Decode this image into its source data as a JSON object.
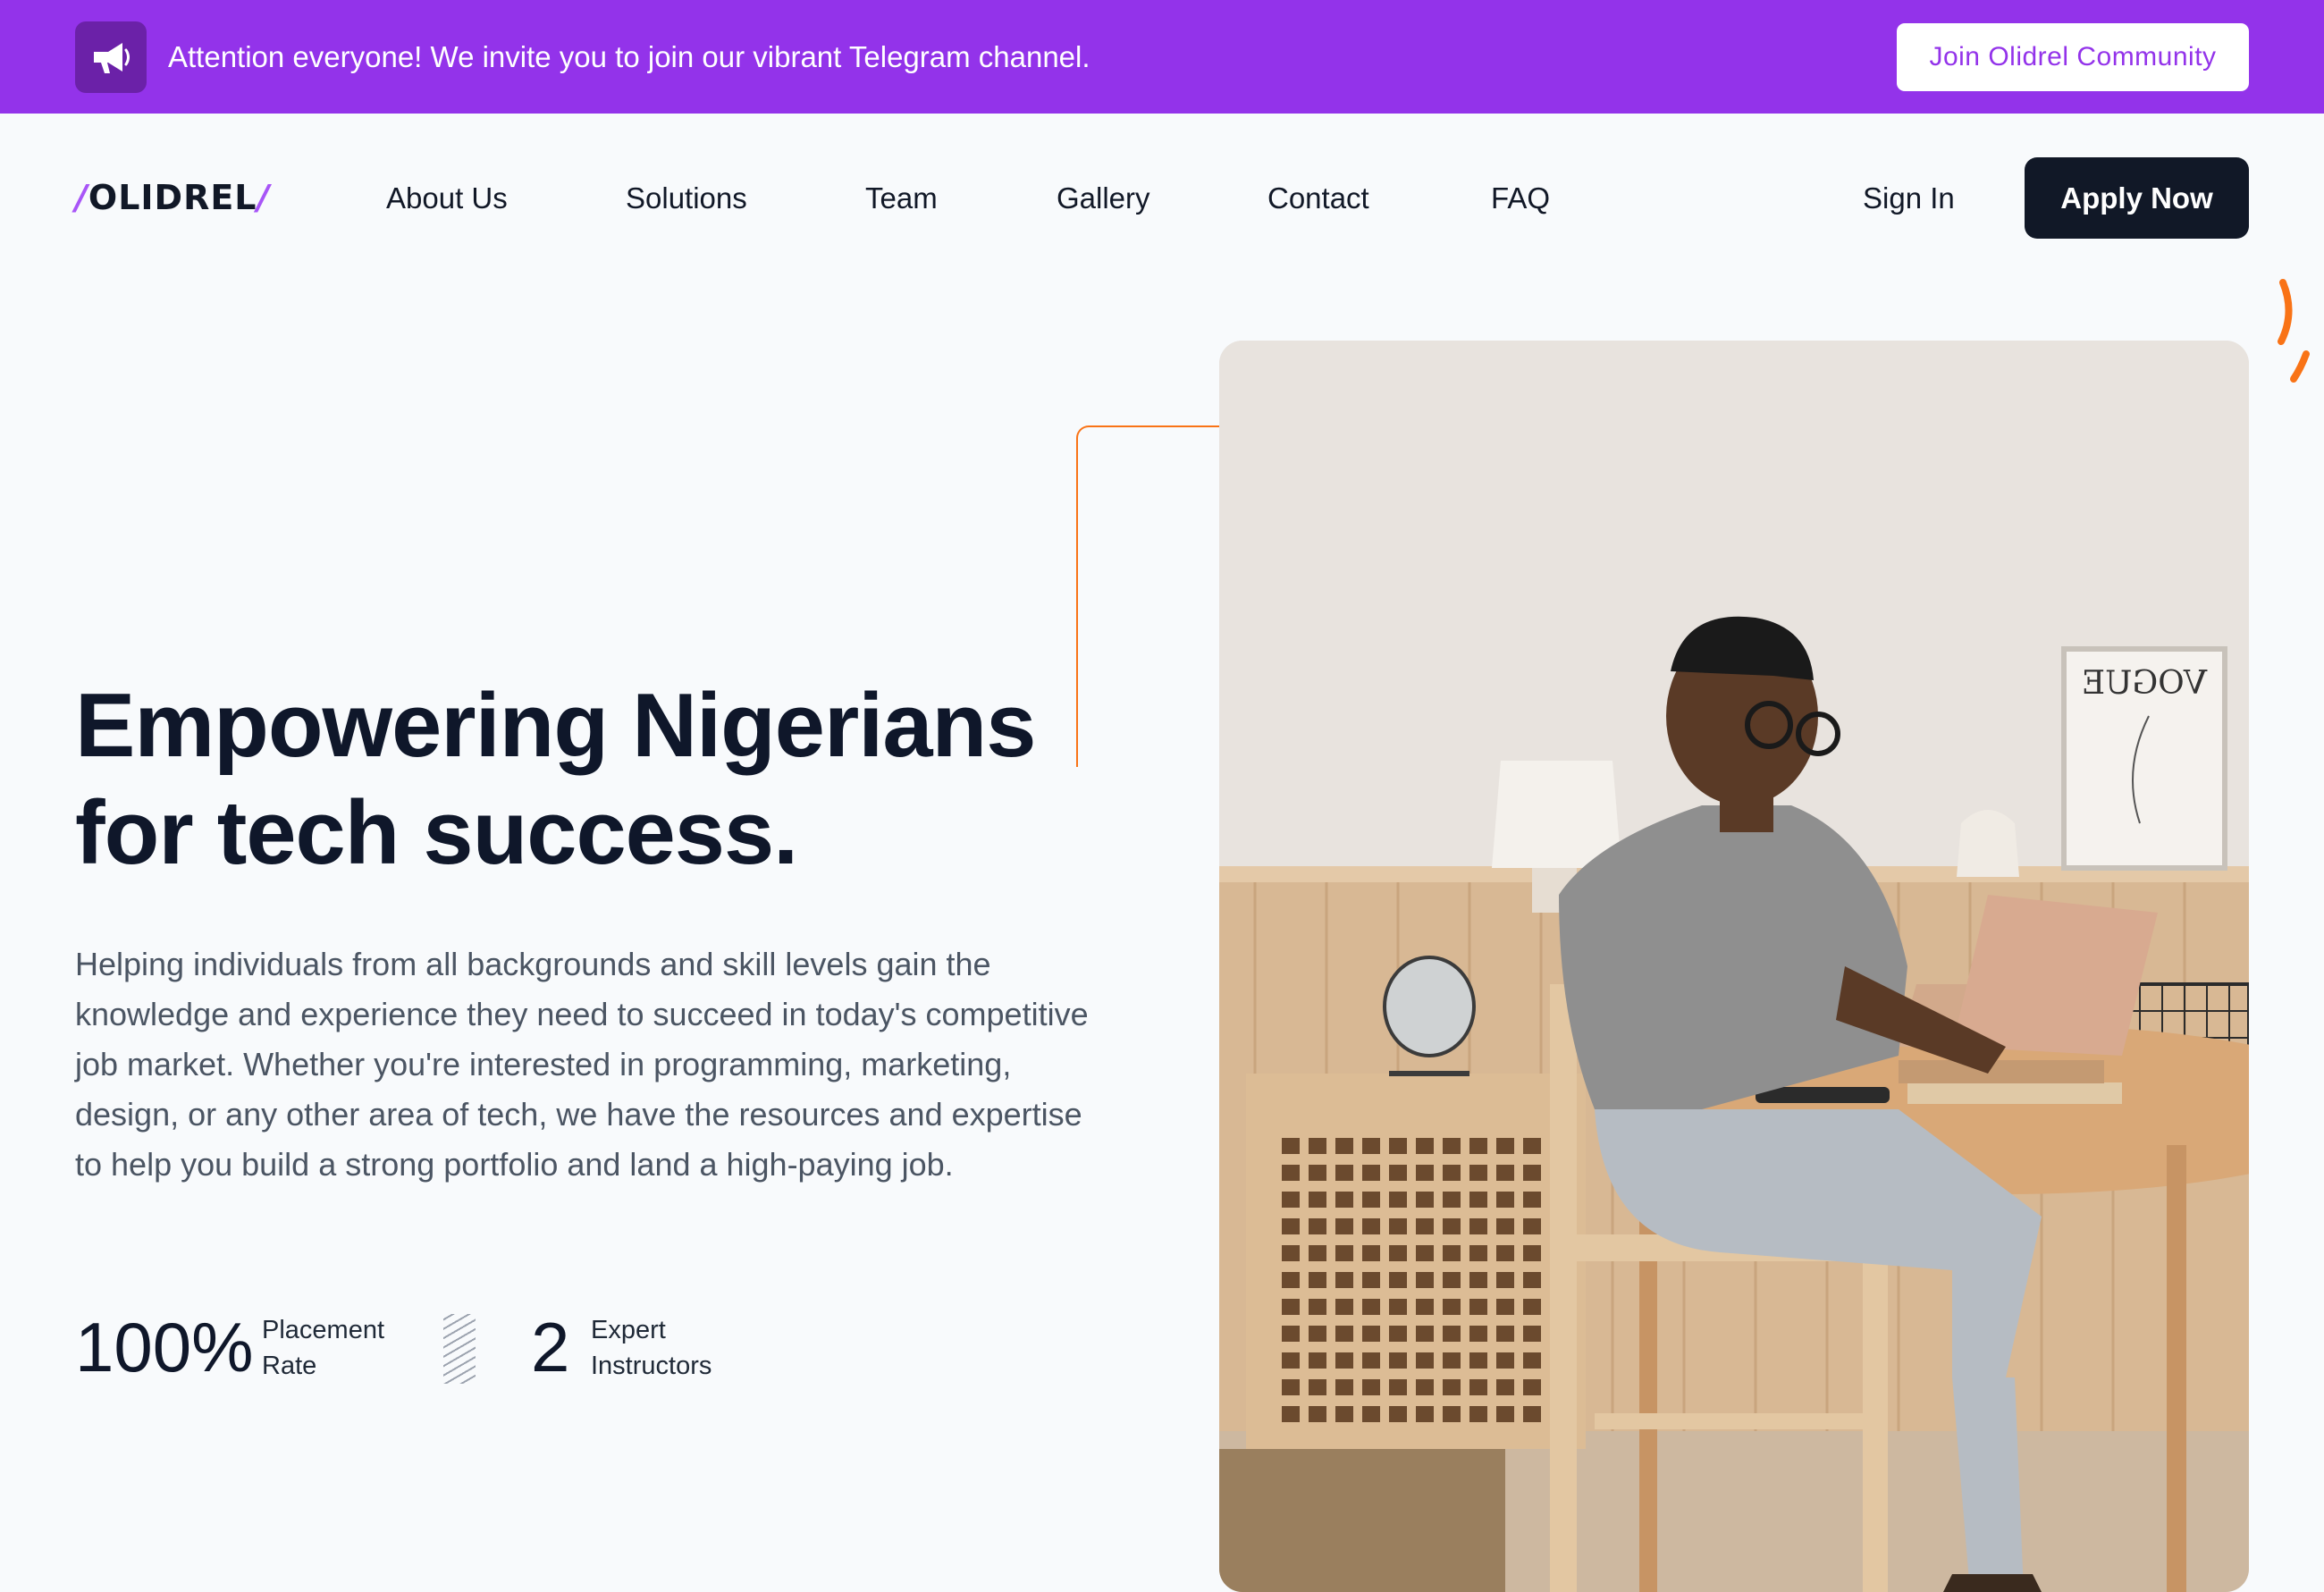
{
  "announcement": {
    "icon": "megaphone-icon",
    "text": "Attention everyone! We invite you to join our vibrant Telegram channel.",
    "button_label": "Join Olidrel Community"
  },
  "header": {
    "logo": {
      "slash_left": "/",
      "wordmark": "OLIDREL",
      "slash_right": "/"
    },
    "nav": [
      "About Us",
      "Solutions",
      "Team",
      "Gallery",
      "Contact",
      "FAQ"
    ],
    "sign_in_label": "Sign In",
    "apply_label": "Apply Now"
  },
  "hero": {
    "headline_line1": "Empowering Nigerians",
    "headline_line2": "for tech success.",
    "description": "Helping individuals from all backgrounds and skill levels gain the knowledge and experience they need to succeed in today's competitive job market. Whether you're interested in programming, marketing, design, or any other area of tech, we have the resources and expertise to help you build a strong portfolio and land a high-paying job.",
    "stats": [
      {
        "value": "100%",
        "label_line1": "Placement",
        "label_line2": "Rate"
      },
      {
        "value": "2",
        "label_line1": "Expert",
        "label_line2": "Instructors"
      }
    ],
    "photo_frame_text": "VOGUE"
  },
  "colors": {
    "brand_purple": "#9333ea",
    "icon_bg": "#6b21a8",
    "dark": "#111827",
    "accent_orange": "#f97316",
    "background": "#f8fafc"
  }
}
